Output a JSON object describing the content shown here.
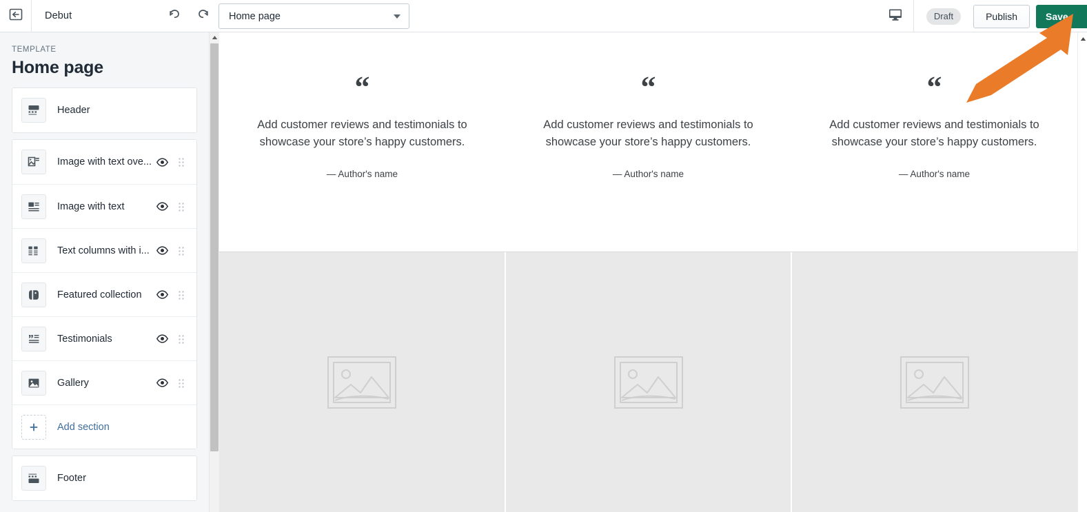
{
  "topbar": {
    "back_icon": "back-arrow-icon",
    "theme_name": "Debut",
    "undo_icon": "undo-icon",
    "redo_icon": "redo-icon",
    "page_selector": {
      "value": "Home page",
      "caret_icon": "chevron-down-icon"
    },
    "device_icon": "desktop-monitor-icon",
    "draft_badge": "Draft",
    "publish_label": "Publish",
    "save_label": "Save",
    "save_color": "#11785a"
  },
  "sidebar": {
    "eyebrow": "TEMPLATE",
    "title": "Home page",
    "groups": [
      {
        "rows": [
          {
            "label": "Header",
            "icon": "header-section-icon",
            "has_eye": false,
            "has_grip": false
          }
        ]
      },
      {
        "rows": [
          {
            "label": "Image with text ove...",
            "icon": "image-with-text-overlay-icon",
            "has_eye": true,
            "has_grip": true
          },
          {
            "label": "Image with text",
            "icon": "image-with-text-icon",
            "has_eye": true,
            "has_grip": true
          },
          {
            "label": "Text columns with i...",
            "icon": "text-columns-with-images-icon",
            "has_eye": true,
            "has_grip": true
          },
          {
            "label": "Featured collection",
            "icon": "tag-icon",
            "has_eye": true,
            "has_grip": true
          },
          {
            "label": "Testimonials",
            "icon": "testimonials-icon",
            "has_eye": true,
            "has_grip": true
          },
          {
            "label": "Gallery",
            "icon": "gallery-image-icon",
            "has_eye": true,
            "has_grip": true
          },
          {
            "label": "Add section",
            "icon": "add-section-icon",
            "has_eye": false,
            "has_grip": false,
            "is_link": true
          }
        ]
      },
      {
        "rows": [
          {
            "label": "Footer",
            "icon": "footer-section-icon",
            "has_eye": false,
            "has_grip": false
          }
        ]
      }
    ],
    "scrollbar": {
      "up_icon": "scroll-up-arrow-icon"
    }
  },
  "preview": {
    "testimonials": [
      {
        "quote_mark": "“",
        "text": "Add customer reviews and testimonials to showcase your store’s happy customers.",
        "author": "— Author's name"
      },
      {
        "quote_mark": "“",
        "text": "Add customer reviews and testimonials to showcase your store’s happy customers.",
        "author": "— Author's name"
      },
      {
        "quote_mark": "“",
        "text": "Add customer reviews and testimonials to showcase your store’s happy customers.",
        "author": "— Author's name"
      }
    ],
    "gallery": [
      {
        "placeholder_icon": "image-placeholder-icon"
      },
      {
        "placeholder_icon": "image-placeholder-icon"
      },
      {
        "placeholder_icon": "image-placeholder-icon"
      }
    ],
    "scrollbar": {
      "up_icon": "scroll-up-arrow-icon"
    }
  },
  "annotation": {
    "arrow_icon": "pointer-arrow-icon",
    "arrow_color": "#ea7b29"
  }
}
